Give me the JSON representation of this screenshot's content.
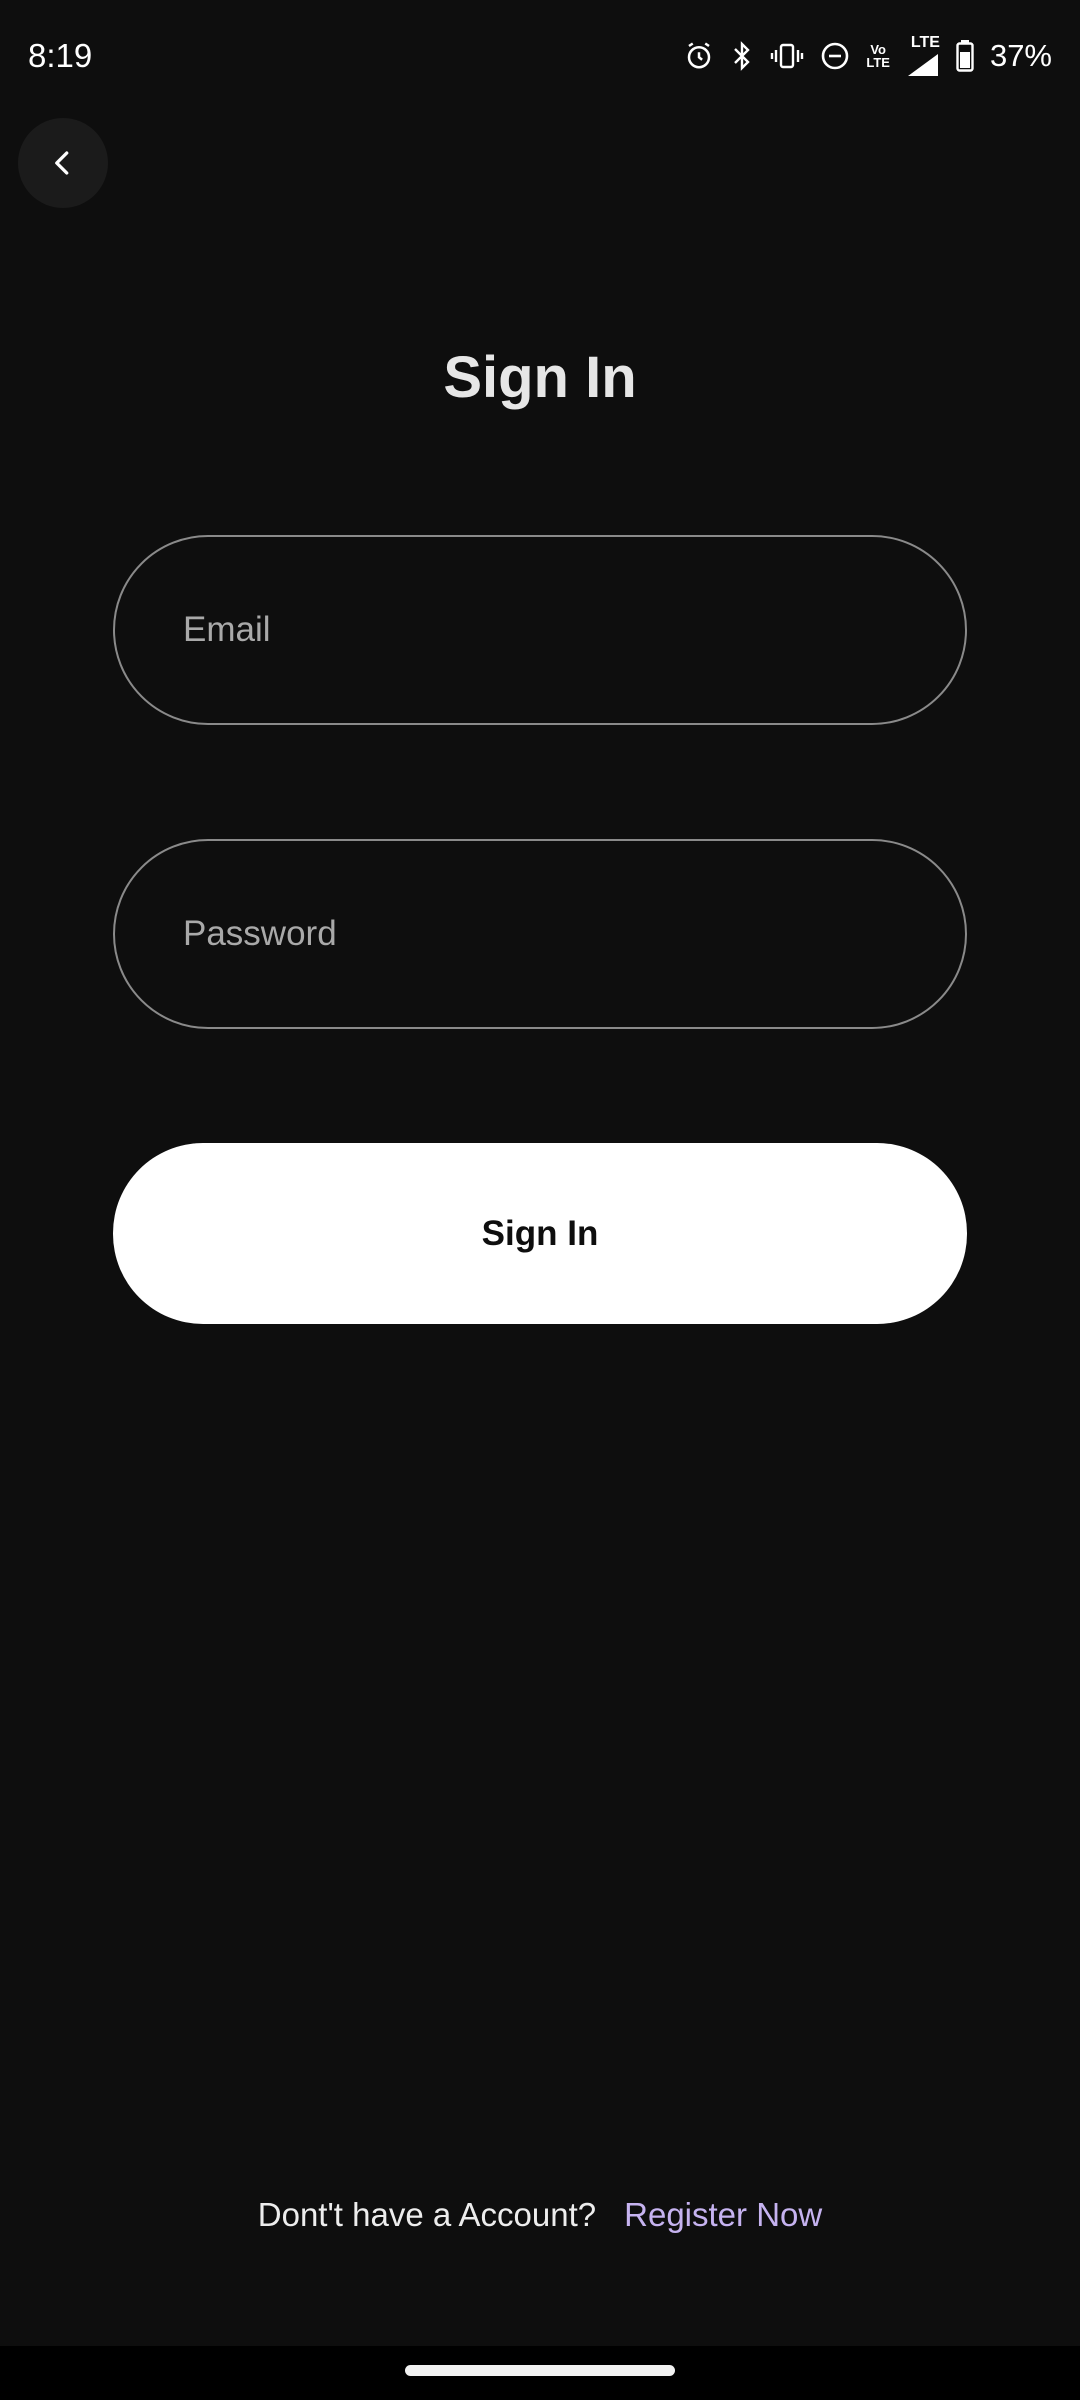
{
  "status_bar": {
    "time": "8:19",
    "volte_top": "Vo",
    "volte_bottom": "LTE",
    "lte_label": "LTE",
    "battery_percent": "37%",
    "icons": [
      "alarm-icon",
      "bluetooth-icon",
      "vibrate-icon",
      "do-not-disturb-icon",
      "volte-icon",
      "lte-signal-icon",
      "signal-icon",
      "battery-icon"
    ]
  },
  "header": {
    "back_icon": "chevron-left-icon",
    "title": "Sign In"
  },
  "form": {
    "email_placeholder": "Email",
    "email_value": "",
    "password_placeholder": "Password",
    "password_value": "",
    "submit_label": "Sign In"
  },
  "footer": {
    "prompt": "Dont't have a Account?",
    "link_label": "Register Now"
  },
  "colors": {
    "background": "#0e0e0e",
    "accent_link": "#c6b3f0",
    "button_bg": "#ffffff",
    "field_border": "#8a8a8a"
  }
}
